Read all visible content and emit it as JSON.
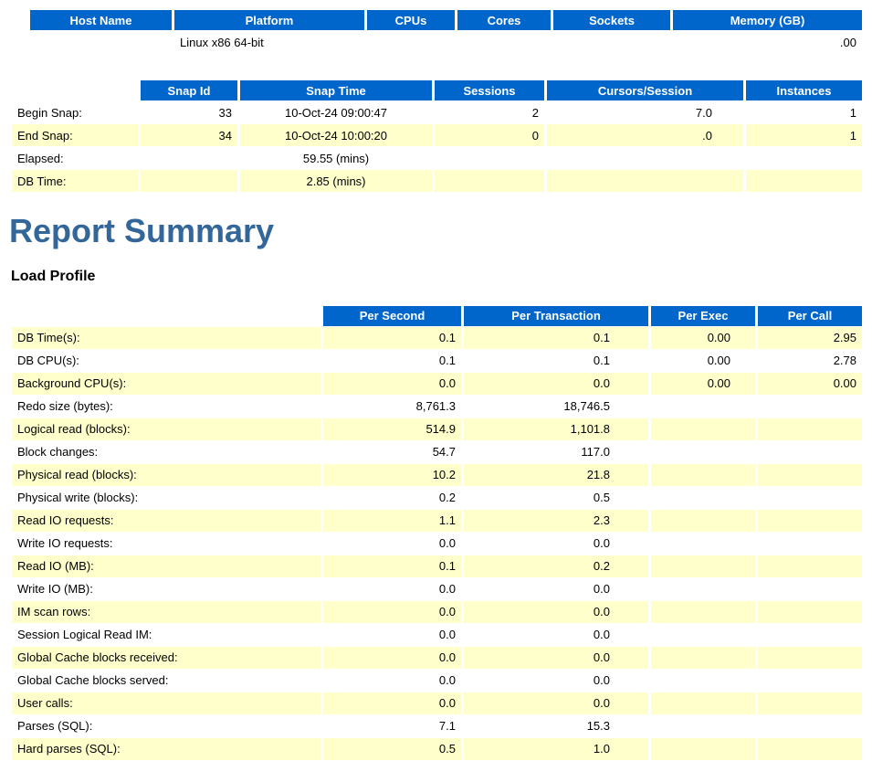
{
  "colors": {
    "table_header_bg": "#0066CC",
    "table_header_text": "#FFFFFF",
    "row_highlight_bg": "#FFFFCC",
    "section_heading_color": "#336699"
  },
  "host_table": {
    "headers": [
      "Host Name",
      "Platform",
      "CPUs",
      "Cores",
      "Sockets",
      "Memory (GB)"
    ],
    "row": [
      "",
      "Linux x86 64-bit",
      "",
      "",
      "",
      ".00"
    ]
  },
  "snapshot_table": {
    "headers": [
      "Snap Id",
      "Snap Time",
      "Sessions",
      "Cursors/Session",
      "Instances"
    ],
    "rows": [
      [
        "Begin Snap:",
        "33",
        "10-Oct-24 09:00:47",
        "2",
        "7.0",
        "1"
      ],
      [
        "End Snap:",
        "34",
        "10-Oct-24 10:00:20",
        "0",
        ".0",
        "1"
      ],
      [
        "Elapsed:",
        "",
        "59.55 (mins)",
        "",
        "",
        ""
      ],
      [
        "DB Time:",
        "",
        "2.85 (mins)",
        "",
        "",
        ""
      ]
    ]
  },
  "report_summary": {
    "heading": "Report Summary"
  },
  "load_profile": {
    "heading": "Load Profile",
    "headers": [
      "Per Second",
      "Per Transaction",
      "Per Exec",
      "Per Call"
    ],
    "rows": [
      [
        "DB Time(s):",
        "0.1",
        "0.1",
        "0.00",
        "2.95"
      ],
      [
        "DB CPU(s):",
        "0.1",
        "0.1",
        "0.00",
        "2.78"
      ],
      [
        "Background CPU(s):",
        "0.0",
        "0.0",
        "0.00",
        "0.00"
      ],
      [
        "Redo size (bytes):",
        "8,761.3",
        "18,746.5",
        "",
        ""
      ],
      [
        "Logical read (blocks):",
        "514.9",
        "1,101.8",
        "",
        ""
      ],
      [
        "Block changes:",
        "54.7",
        "117.0",
        "",
        ""
      ],
      [
        "Physical read (blocks):",
        "10.2",
        "21.8",
        "",
        ""
      ],
      [
        "Physical write (blocks):",
        "0.2",
        "0.5",
        "",
        ""
      ],
      [
        "Read IO requests:",
        "1.1",
        "2.3",
        "",
        ""
      ],
      [
        "Write IO requests:",
        "0.0",
        "0.0",
        "",
        ""
      ],
      [
        "Read IO (MB):",
        "0.1",
        "0.2",
        "",
        ""
      ],
      [
        "Write IO (MB):",
        "0.0",
        "0.0",
        "",
        ""
      ],
      [
        "IM scan rows:",
        "0.0",
        "0.0",
        "",
        ""
      ],
      [
        "Session Logical Read IM:",
        "0.0",
        "0.0",
        "",
        ""
      ],
      [
        "Global Cache blocks received:",
        "0.0",
        "0.0",
        "",
        ""
      ],
      [
        "Global Cache blocks served:",
        "0.0",
        "0.0",
        "",
        ""
      ],
      [
        "User calls:",
        "0.0",
        "0.0",
        "",
        ""
      ],
      [
        "Parses (SQL):",
        "7.1",
        "15.3",
        "",
        ""
      ],
      [
        "Hard parses (SQL):",
        "0.5",
        "1.0",
        "",
        ""
      ]
    ]
  }
}
